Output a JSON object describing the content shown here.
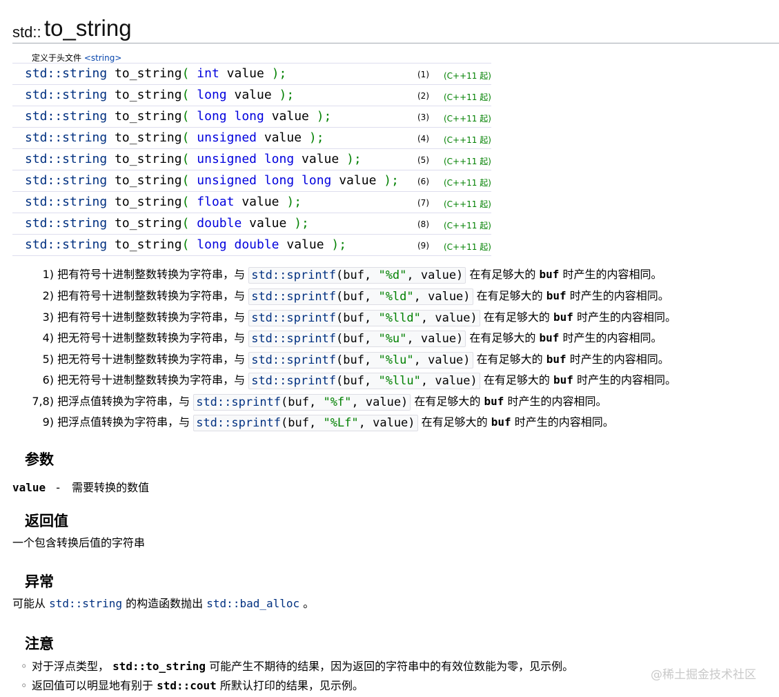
{
  "title": {
    "namespace": "std::",
    "name": "to_string"
  },
  "header": {
    "prefix": "定义于头文件",
    "file": "<string>"
  },
  "declarations": [
    {
      "ret": "std::string",
      "fn": "to_string",
      "open": "(",
      "kw": "int",
      "param": "value",
      "close": ");",
      "num": "(1)",
      "since": "(C++11 起)"
    },
    {
      "ret": "std::string",
      "fn": "to_string",
      "open": "(",
      "kw": "long",
      "param": "value",
      "close": ");",
      "num": "(2)",
      "since": "(C++11 起)"
    },
    {
      "ret": "std::string",
      "fn": "to_string",
      "open": "(",
      "kw": "long long",
      "param": "value",
      "close": ");",
      "num": "(3)",
      "since": "(C++11 起)"
    },
    {
      "ret": "std::string",
      "fn": "to_string",
      "open": "(",
      "kw": "unsigned",
      "param": "value",
      "close": ");",
      "num": "(4)",
      "since": "(C++11 起)"
    },
    {
      "ret": "std::string",
      "fn": "to_string",
      "open": "(",
      "kw": "unsigned long",
      "param": "value",
      "close": ");",
      "num": "(5)",
      "since": "(C++11 起)"
    },
    {
      "ret": "std::string",
      "fn": "to_string",
      "open": "(",
      "kw": "unsigned long long",
      "param": "value",
      "close": ");",
      "num": "(6)",
      "since": "(C++11 起)"
    },
    {
      "ret": "std::string",
      "fn": "to_string",
      "open": "(",
      "kw": "float",
      "param": "value",
      "close": ");",
      "num": "(7)",
      "since": "(C++11 起)"
    },
    {
      "ret": "std::string",
      "fn": "to_string",
      "open": "(",
      "kw": "double",
      "param": "value",
      "close": ");",
      "num": "(8)",
      "since": "(C++11 起)"
    },
    {
      "ret": "std::string",
      "fn": "to_string",
      "open": "(",
      "kw": "long double",
      "param": "value",
      "close": ");",
      "num": "(9)",
      "since": "(C++11 起)"
    }
  ],
  "descriptions": [
    {
      "n": "1)",
      "text": "把有符号十进制整数转换为字符串，与",
      "fn": "std::sprintf",
      "a1": "(buf, ",
      "fmt": "\"%d\"",
      "a2": ", value)",
      "tail_a": "在有足够大的",
      "buf": "buf",
      "tail_b": "时产生的内容相同。"
    },
    {
      "n": "2)",
      "text": "把有符号十进制整数转换为字符串，与",
      "fn": "std::sprintf",
      "a1": "(buf, ",
      "fmt": "\"%ld\"",
      "a2": ", value)",
      "tail_a": "在有足够大的",
      "buf": "buf",
      "tail_b": "时产生的内容相同。"
    },
    {
      "n": "3)",
      "text": "把有符号十进制整数转换为字符串，与",
      "fn": "std::sprintf",
      "a1": "(buf, ",
      "fmt": "\"%lld\"",
      "a2": ", value)",
      "tail_a": "在有足够大的",
      "buf": "buf",
      "tail_b": "时产生的内容相同。"
    },
    {
      "n": "4)",
      "text": "把无符号十进制整数转换为字符串，与",
      "fn": "std::sprintf",
      "a1": "(buf, ",
      "fmt": "\"%u\"",
      "a2": ", value)",
      "tail_a": "在有足够大的",
      "buf": "buf",
      "tail_b": "时产生的内容相同。"
    },
    {
      "n": "5)",
      "text": "把无符号十进制整数转换为字符串，与",
      "fn": "std::sprintf",
      "a1": "(buf, ",
      "fmt": "\"%lu\"",
      "a2": ", value)",
      "tail_a": "在有足够大的",
      "buf": "buf",
      "tail_b": "时产生的内容相同。"
    },
    {
      "n": "6)",
      "text": "把无符号十进制整数转换为字符串，与",
      "fn": "std::sprintf",
      "a1": "(buf, ",
      "fmt": "\"%llu\"",
      "a2": ", value)",
      "tail_a": "在有足够大的",
      "buf": "buf",
      "tail_b": "时产生的内容相同。"
    },
    {
      "n": "7,8)",
      "text": "把浮点值转换为字符串，与",
      "fn": "std::sprintf",
      "a1": "(buf, ",
      "fmt": "\"%f\"",
      "a2": ", value)",
      "tail_a": "在有足够大的",
      "buf": "buf",
      "tail_b": "时产生的内容相同。"
    },
    {
      "n": "9)",
      "text": "把浮点值转换为字符串，与",
      "fn": "std::sprintf",
      "a1": "(buf, ",
      "fmt": "\"%Lf\"",
      "a2": ", value)",
      "tail_a": "在有足够大的",
      "buf": "buf",
      "tail_b": "时产生的内容相同。"
    }
  ],
  "params": {
    "heading": "参数",
    "name": "value",
    "dash": "-",
    "desc": "需要转换的数值"
  },
  "returns": {
    "heading": "返回值",
    "text": "一个包含转换后值的字符串"
  },
  "exceptions": {
    "heading": "异常",
    "pre": "可能从",
    "link1": "std::string",
    "mid": "的构造函数抛出",
    "link2": "std::bad_alloc",
    "post": "。"
  },
  "notes": {
    "heading": "注意",
    "items": [
      {
        "pre": "对于浮点类型，",
        "code": "std::to_string",
        "post": "可能产生不期待的结果，因为返回的字符串中的有效位数能为零，见示例。"
      },
      {
        "pre": "返回值可以明显地有别于",
        "code": "std::cout",
        "post": "所默认打印的结果，见示例。"
      }
    ]
  },
  "watermark": "@稀土掘金技术社区"
}
